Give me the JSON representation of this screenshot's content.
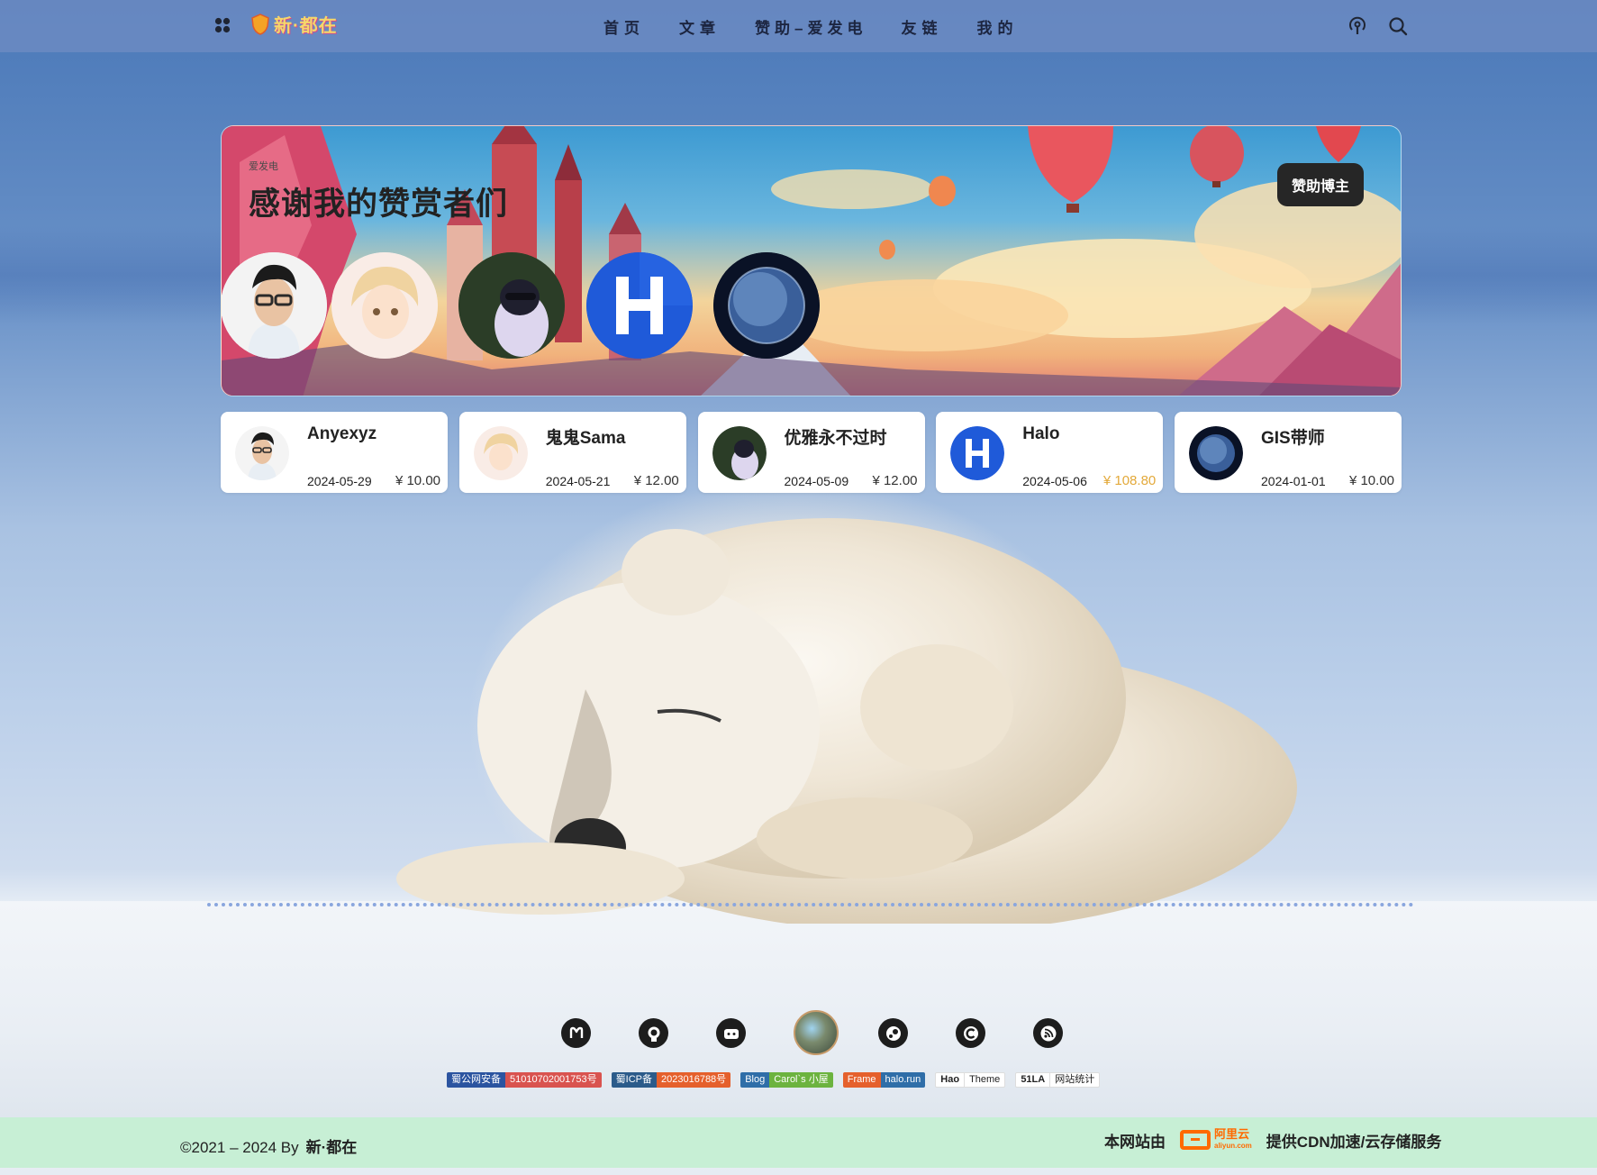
{
  "header": {
    "logo_text": "新·都在",
    "nav": [
      "首页",
      "文章",
      "赞助–爱发电",
      "友链",
      "我的"
    ]
  },
  "banner": {
    "subtitle": "爱发电",
    "title": "感谢我的赞赏者们",
    "button_label": "赞助博主"
  },
  "sponsors": [
    {
      "name": "Anyexyz",
      "date": "2024-05-29",
      "amount": "¥ 10.00",
      "highlight": false
    },
    {
      "name": "鬼鬼Sama",
      "date": "2024-05-21",
      "amount": "¥ 12.00",
      "highlight": false
    },
    {
      "name": "优雅永不过时",
      "date": "2024-05-09",
      "amount": "¥ 12.00",
      "highlight": false
    },
    {
      "name": "Halo",
      "date": "2024-05-06",
      "amount": "¥ 108.80",
      "highlight": true
    },
    {
      "name": "GIS带师",
      "date": "2024-01-01",
      "amount": "¥ 10.00",
      "highlight": false
    }
  ],
  "social_icons": [
    "mastodon-icon",
    "github-icon",
    "bilibili-icon",
    "avatar-globe",
    "steam-icon",
    "csdn-icon",
    "rss-icon"
  ],
  "badges": {
    "police": {
      "left": "蜀公网安备",
      "right": "51010702001753号"
    },
    "icp": {
      "left": "蜀ICP备",
      "right": "2023016788号"
    },
    "blog": {
      "left": "Blog",
      "right": "Carol`s 小屋"
    },
    "frame": {
      "left": "Frame",
      "right": "halo.run"
    },
    "theme": {
      "left": "Hao",
      "right": "Theme"
    },
    "stats": {
      "left": "51LA",
      "right": "网站统计"
    }
  },
  "footer": {
    "copyright": "©2021 – 2024 By",
    "author": "新·都在",
    "hosted_prefix": "本网站由",
    "aliyun_cn": "阿里云",
    "aliyun_en": "aliyun.com",
    "hosted_suffix": "提供CDN加速/云存储服务"
  },
  "colors": {
    "accent_gold": "#e3a93a",
    "footer_bg": "#c7efd5",
    "topbar_bg": "#6e8cc3"
  }
}
